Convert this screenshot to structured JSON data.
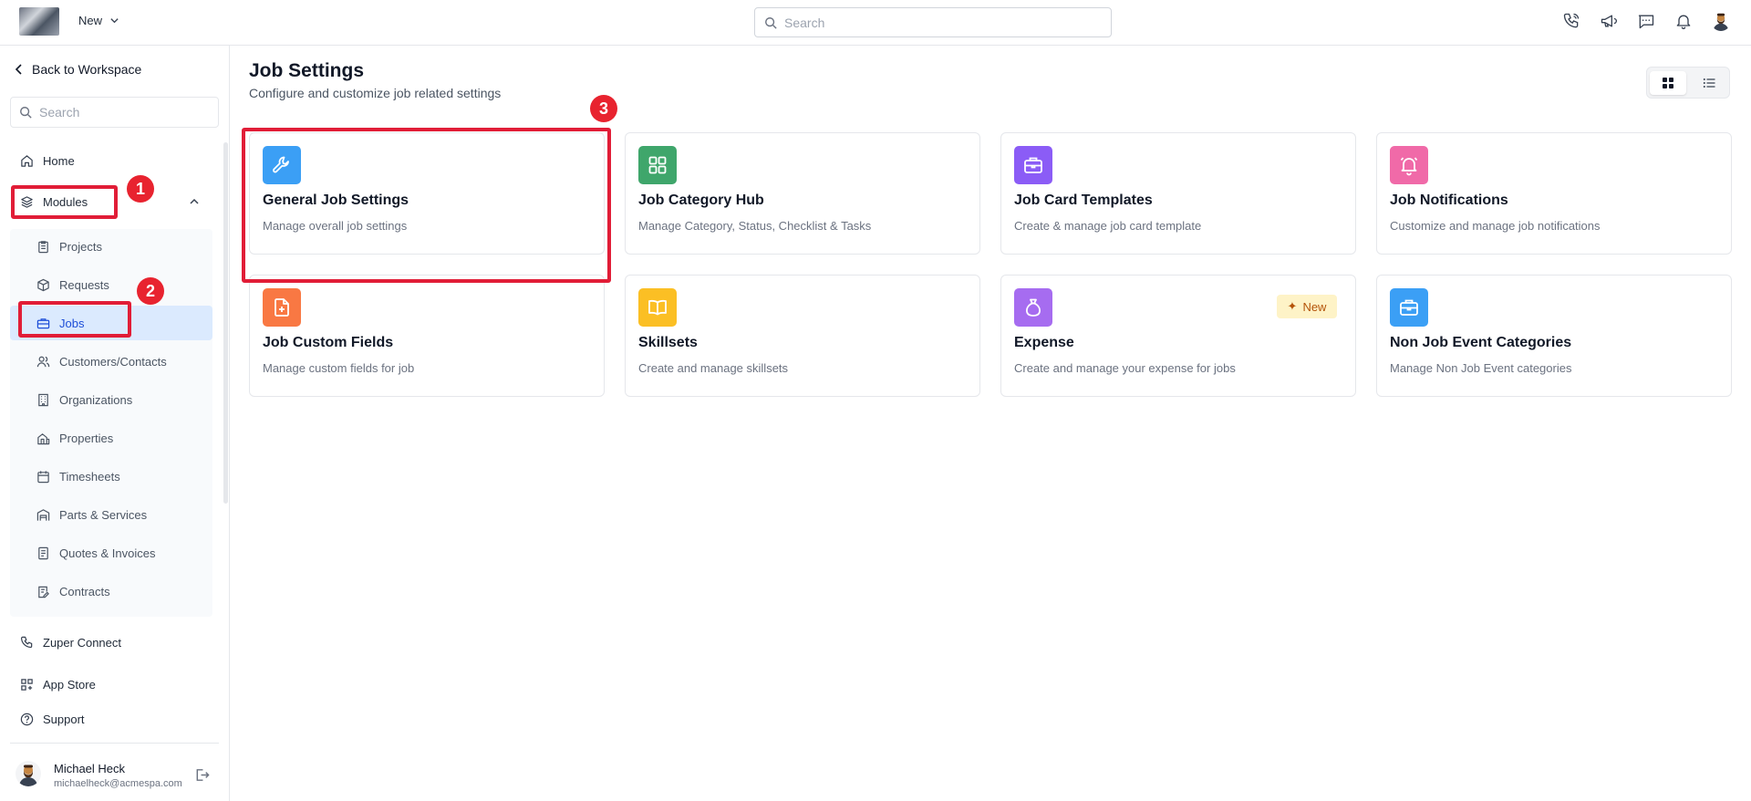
{
  "topbar": {
    "new_label": "New",
    "search_placeholder": "Search"
  },
  "sidebar": {
    "back_label": "Back to Workspace",
    "search_placeholder": "Search",
    "home_label": "Home",
    "modules_label": "Modules",
    "submenu": [
      {
        "label": "Projects",
        "icon": "clipboard-icon"
      },
      {
        "label": "Requests",
        "icon": "box-icon"
      },
      {
        "label": "Jobs",
        "icon": "briefcase-icon",
        "active": true
      },
      {
        "label": "Customers/Contacts",
        "icon": "users-icon"
      },
      {
        "label": "Organizations",
        "icon": "building-icon"
      },
      {
        "label": "Properties",
        "icon": "property-icon"
      },
      {
        "label": "Timesheets",
        "icon": "calendar-icon"
      },
      {
        "label": "Parts & Services",
        "icon": "warehouse-icon"
      },
      {
        "label": "Quotes & Invoices",
        "icon": "invoice-icon"
      },
      {
        "label": "Contracts",
        "icon": "contract-icon"
      }
    ],
    "zuper_connect_label": "Zuper Connect",
    "app_store_label": "App Store",
    "support_label": "Support",
    "user": {
      "name": "Michael Heck",
      "email": "michaelheck@acmespa.com"
    }
  },
  "main": {
    "title": "Job Settings",
    "subtitle": "Configure and customize job related settings",
    "cards": [
      {
        "title": "General Job Settings",
        "desc": "Manage overall job settings",
        "icon": "wrench-icon",
        "color": "#3b9ff5"
      },
      {
        "title": "Job Category Hub",
        "desc": "Manage Category, Status, Checklist & Tasks",
        "icon": "grid-icon",
        "color": "#3fa66b"
      },
      {
        "title": "Job Card Templates",
        "desc": "Create & manage job card template",
        "icon": "briefcase-icon",
        "color": "#8b5cf6"
      },
      {
        "title": "Job Notifications",
        "desc": "Customize and manage job notifications",
        "icon": "bell-icon",
        "color": "#f06aa8"
      },
      {
        "title": "Job Custom Fields",
        "desc": "Manage custom fields for job",
        "icon": "file-plus-icon",
        "color": "#f97843"
      },
      {
        "title": "Skillsets",
        "desc": "Create and manage skillsets",
        "icon": "book-icon",
        "color": "#fbbf24"
      },
      {
        "title": "Expense",
        "desc": "Create and manage your expense for jobs",
        "icon": "money-bag-icon",
        "color": "#a66cf0",
        "badge": "New"
      },
      {
        "title": "Non Job Event Categories",
        "desc": "Manage Non Job Event categories",
        "icon": "briefcase-icon",
        "color": "#3b9ff5"
      }
    ]
  },
  "annotations": [
    "1",
    "2",
    "3"
  ],
  "colors": {
    "accent": "#1d4ed8",
    "annotation": "#e11d37"
  }
}
